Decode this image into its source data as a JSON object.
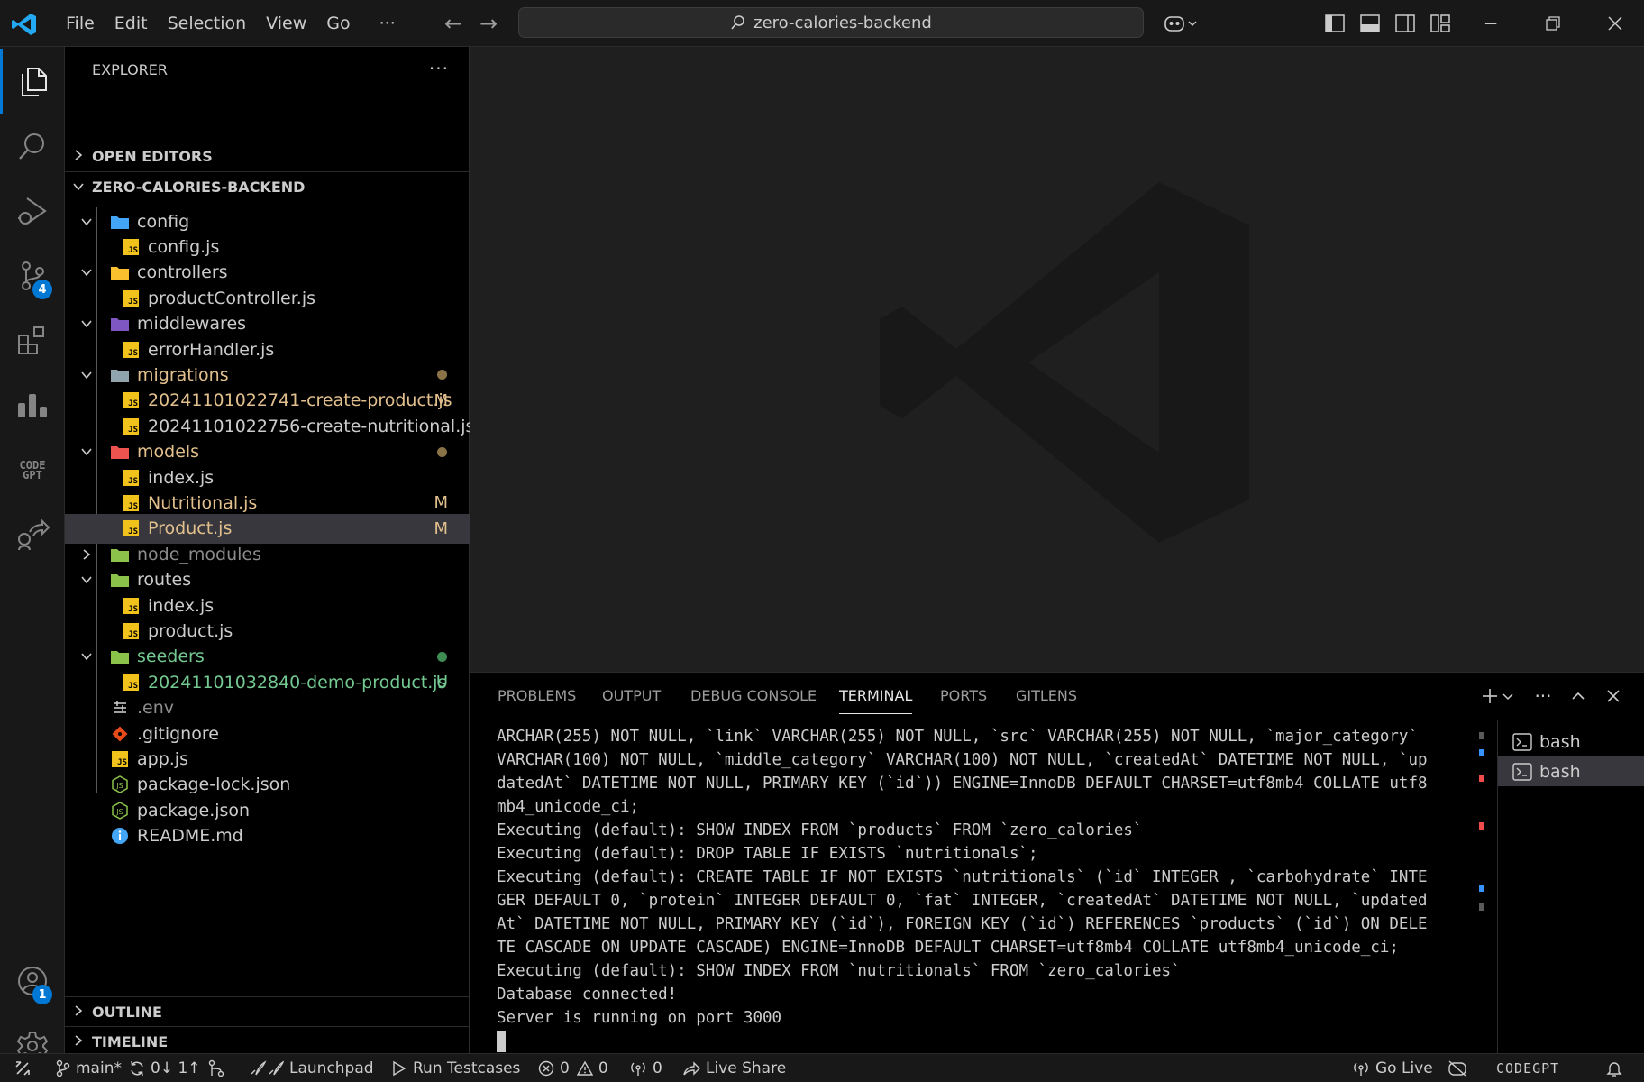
{
  "titlebar": {
    "menu": [
      "File",
      "Edit",
      "Selection",
      "View",
      "Go",
      "···"
    ],
    "search_text": "zero-calories-backend",
    "colors": {
      "accent": "#0078d4",
      "logo": "#23a9f2"
    }
  },
  "activitybar": {
    "source_control_badge": "4",
    "accounts_badge": "1",
    "codegpt_label": "CODE GPT"
  },
  "sidebar": {
    "title": "EXPLORER",
    "more": "···",
    "open_editors": "OPEN EDITORS",
    "root": "ZERO-CALORIES-BACKEND",
    "items": [
      {
        "label": "config",
        "type": "folder",
        "icon": "config-folder-icon"
      },
      {
        "label": "config.js",
        "type": "js"
      },
      {
        "label": "controllers",
        "type": "folder",
        "icon": "controllers-folder-icon"
      },
      {
        "label": "productController.js",
        "type": "js"
      },
      {
        "label": "middlewares",
        "type": "folder",
        "icon": "middlewares-folder-icon"
      },
      {
        "label": "errorHandler.js",
        "type": "js"
      },
      {
        "label": "migrations",
        "type": "folder",
        "status": "modified"
      },
      {
        "label": "20241101022741-create-product.js",
        "type": "js",
        "status": "M"
      },
      {
        "label": "20241101022756-create-nutritional.js",
        "type": "js"
      },
      {
        "label": "models",
        "type": "folder",
        "status": "modified"
      },
      {
        "label": "index.js",
        "type": "js"
      },
      {
        "label": "Nutritional.js",
        "type": "js",
        "status": "M"
      },
      {
        "label": "Product.js",
        "type": "js",
        "status": "M"
      },
      {
        "label": "node_modules",
        "type": "folder"
      },
      {
        "label": "routes",
        "type": "folder"
      },
      {
        "label": "index.js",
        "type": "js"
      },
      {
        "label": "product.js",
        "type": "js"
      },
      {
        "label": "seeders",
        "type": "folder",
        "status": "untracked"
      },
      {
        "label": "20241101032840-demo-product.js",
        "type": "js",
        "status": "U"
      },
      {
        "label": ".env",
        "type": "env"
      },
      {
        "label": ".gitignore",
        "type": "git"
      },
      {
        "label": "app.js",
        "type": "js"
      },
      {
        "label": "package-lock.json",
        "type": "json"
      },
      {
        "label": "package.json",
        "type": "json"
      },
      {
        "label": "README.md",
        "type": "info"
      }
    ],
    "outline": "OUTLINE",
    "timeline": "TIMELINE"
  },
  "panel": {
    "tabs": [
      "PROBLEMS",
      "OUTPUT",
      "DEBUG CONSOLE",
      "TERMINAL",
      "PORTS",
      "GITLENS"
    ],
    "active_tab": "TERMINAL",
    "terminal_lines": [
      "ARCHAR(255) NOT NULL, `link` VARCHAR(255) NOT NULL, `src` VARCHAR(255) NOT NULL, `major_category`",
      "VARCHAR(100) NOT NULL, `middle_category` VARCHAR(100) NOT NULL, `createdAt` DATETIME NOT NULL, `up",
      "datedAt` DATETIME NOT NULL, PRIMARY KEY (`id`)) ENGINE=InnoDB DEFAULT CHARSET=utf8mb4 COLLATE utf8",
      "mb4_unicode_ci;",
      "Executing (default): SHOW INDEX FROM `products` FROM `zero_calories`",
      "Executing (default): DROP TABLE IF EXISTS `nutritionals`;",
      "Executing (default): CREATE TABLE IF NOT EXISTS `nutritionals` (`id` INTEGER , `carbohydrate` INTE",
      "GER DEFAULT 0, `protein` INTEGER DEFAULT 0, `fat` INTEGER, `createdAt` DATETIME NOT NULL, `updated",
      "At` DATETIME NOT NULL, PRIMARY KEY (`id`), FOREIGN KEY (`id`) REFERENCES `products` (`id`) ON DELE",
      "TE CASCADE ON UPDATE CASCADE) ENGINE=InnoDB DEFAULT CHARSET=utf8mb4 COLLATE utf8mb4_unicode_ci;",
      "Executing (default): SHOW INDEX FROM `nutritionals` FROM `zero_calories`",
      "Database connected!",
      "Server is running on port 3000"
    ],
    "terminals": [
      "bash",
      "bash"
    ]
  },
  "statusbar": {
    "branch": "main*",
    "sync": "0↓ 1↑",
    "launchpad": "Launchpad",
    "run_testcases": "Run Testcases",
    "errors": "0",
    "warnings": "0",
    "ports": "0",
    "live_share": "Live Share",
    "go_live": "Go Live",
    "codegpt": "CODEGPT"
  }
}
